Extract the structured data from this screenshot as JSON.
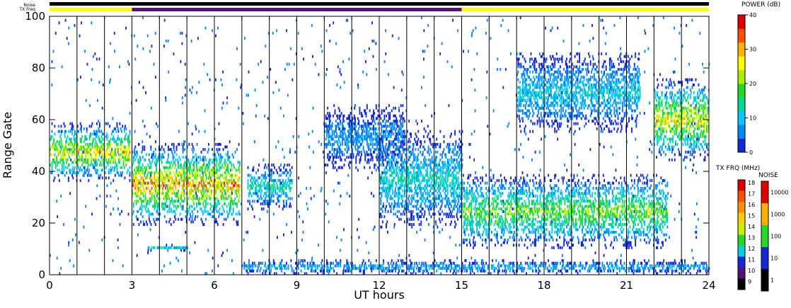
{
  "chart_data": {
    "type": "heatmap",
    "xlabel": "UT hours",
    "ylabel": "Range Gate",
    "xlim": [
      0,
      24
    ],
    "ylim": [
      0,
      100
    ],
    "x_ticks": [
      "0",
      "3",
      "6",
      "9",
      "12",
      "15",
      "18",
      "21",
      "24"
    ],
    "y_ticks": [
      "0",
      "20",
      "40",
      "60",
      "80",
      "100"
    ],
    "grid": "vertical lines every hour",
    "top_bars": {
      "noise_label": "Noise",
      "txfreq_label": "TX Freq",
      "noise_segments": [
        {
          "start": 0,
          "end": 24,
          "color": "#000000"
        }
      ],
      "txfreq_segments": [
        {
          "start": 0,
          "end": 3,
          "color": "#ffff00"
        },
        {
          "start": 3,
          "end": 15,
          "color": "#55107a"
        },
        {
          "start": 15,
          "end": 24,
          "color": "#ffff00"
        }
      ]
    },
    "power_scale": {
      "title": "POWER (dB)",
      "min": 0,
      "max": 40,
      "ticks": [
        "40",
        "30",
        "20",
        "10",
        "0"
      ],
      "colors": [
        "#1428d8",
        "#0088ff",
        "#00c8ff",
        "#00d890",
        "#28d828",
        "#a8f000",
        "#ffff00",
        "#ffb000",
        "#ff5000",
        "#e00000"
      ]
    },
    "txfreq_scale": {
      "title": "TX FRQ (MHz)",
      "ticks": [
        "18",
        "17",
        "16",
        "15",
        "14",
        "13",
        "12",
        "11",
        "10",
        "9"
      ],
      "colors": [
        "#e00000",
        "#ff5000",
        "#ff9000",
        "#ffd000",
        "#c8f000",
        "#28d828",
        "#00d0e0",
        "#1428d8",
        "#55107a",
        "#000000"
      ]
    },
    "noise_scale": {
      "title": "NOISE",
      "ticks": [
        "10000",
        "1000",
        "100",
        "10",
        "1"
      ],
      "colors": [
        "#e00000",
        "#ffb000",
        "#28d828",
        "#1428d8",
        "#000000"
      ]
    },
    "echo_regions": [
      {
        "t0": 0,
        "t1": 2.9,
        "r_lo": 36,
        "r_hi": 58,
        "peak_db": 28
      },
      {
        "t0": 3.0,
        "t1": 6.9,
        "r_lo": 19,
        "r_hi": 50,
        "peak_db": 32
      },
      {
        "t0": 3.5,
        "t1": 5.0,
        "r_lo": 9,
        "r_hi": 11,
        "peak_db": 12
      },
      {
        "t0": 7.2,
        "t1": 8.8,
        "r_lo": 25,
        "r_hi": 42,
        "peak_db": 15
      },
      {
        "t0": 10.0,
        "t1": 12.9,
        "r_lo": 40,
        "r_hi": 65,
        "peak_db": 8
      },
      {
        "t0": 12.0,
        "t1": 15.0,
        "r_lo": 18,
        "r_hi": 55,
        "peak_db": 14
      },
      {
        "t0": 15.0,
        "t1": 22.5,
        "r_lo": 10,
        "r_hi": 38,
        "peak_db": 22
      },
      {
        "t0": 17.0,
        "t1": 21.5,
        "r_lo": 55,
        "r_hi": 85,
        "peak_db": 12
      },
      {
        "t0": 22.0,
        "t1": 24.0,
        "r_lo": 44,
        "r_hi": 75,
        "peak_db": 28
      },
      {
        "t0": 7.0,
        "t1": 24.0,
        "r_lo": 0,
        "r_hi": 5,
        "peak_db": 10
      }
    ]
  }
}
